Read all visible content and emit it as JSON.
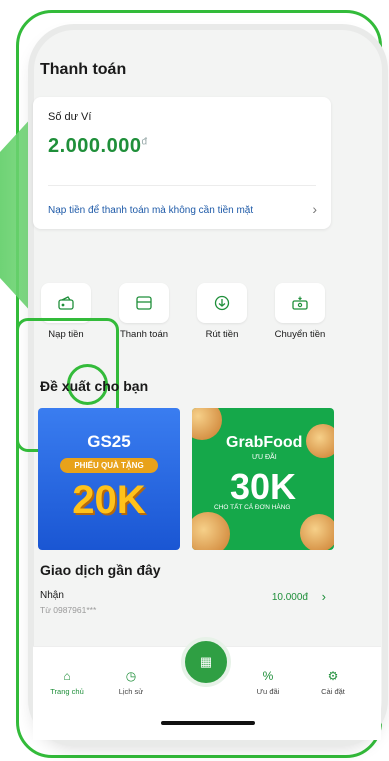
{
  "colors": {
    "accent": "#33bb3a",
    "brand_green": "#1f8f3a",
    "link_blue": "#1e5aa8"
  },
  "header": {
    "title": "Thanh toán"
  },
  "wallet": {
    "label": "Số dư Ví",
    "balance": "2.000.000",
    "currency": "đ",
    "topup_link": "Nạp tiền để thanh toán mà không cần tiền mặt"
  },
  "actions": [
    {
      "label": "Nạp tiền",
      "icon": "wallet-topup-icon"
    },
    {
      "label": "Thanh toán",
      "icon": "card-icon"
    },
    {
      "label": "Rút tiền",
      "icon": "withdraw-icon"
    },
    {
      "label": "Chuyển tiền",
      "icon": "transfer-icon"
    }
  ],
  "suggest": {
    "title": "Đề xuất cho bạn",
    "promos": [
      {
        "brand": "GS25",
        "tag": "PHIẾU QUÀ TẶNG",
        "value": "20K"
      },
      {
        "brand": "GrabFood",
        "tag": "ƯU ĐÃI",
        "value": "30K",
        "note": "CHO TẤT CẢ ĐƠN HÀNG"
      }
    ]
  },
  "recent": {
    "title": "Giao dịch gần đây",
    "items": [
      {
        "type": "Nhận",
        "from": "Từ 0987961***",
        "amount": "10.000đ"
      }
    ]
  },
  "nav": [
    {
      "label": "Trang chủ",
      "icon": "home-icon"
    },
    {
      "label": "Lịch sử",
      "icon": "history-icon"
    },
    {
      "label": "",
      "icon": "qr-scan-icon"
    },
    {
      "label": "Ưu đãi",
      "icon": "percent-icon"
    },
    {
      "label": "Cài đặt",
      "icon": "settings-icon"
    }
  ]
}
